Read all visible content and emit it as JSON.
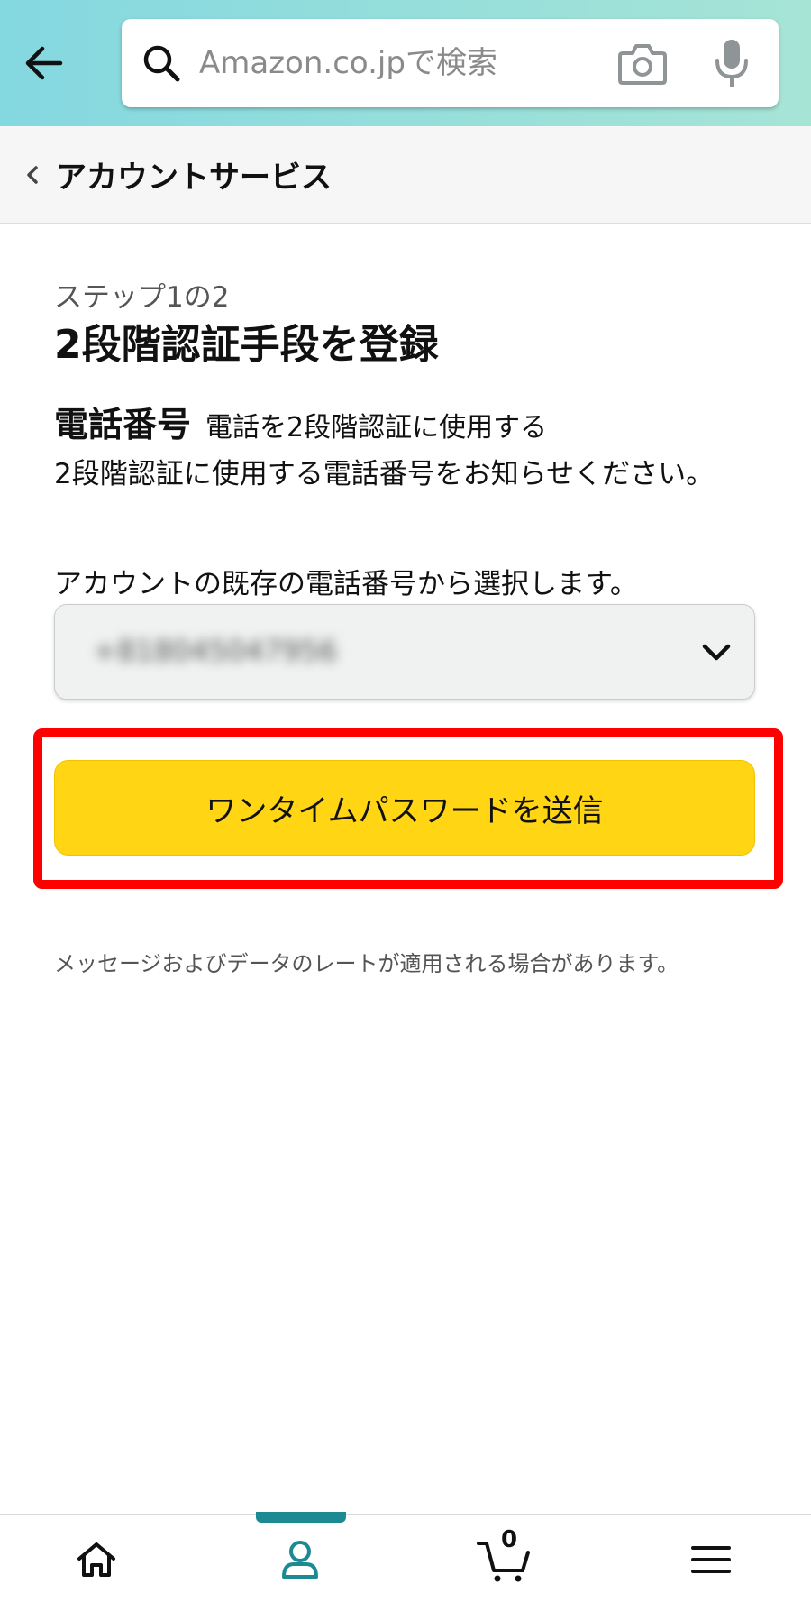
{
  "header": {
    "search_placeholder": "Amazon.co.jpで検索"
  },
  "breadcrumb": {
    "label": "アカウントサービス"
  },
  "main": {
    "step": "ステップ1の2",
    "title": "2段階認証手段を登録",
    "section_title": "電話番号",
    "section_subtitle": "電話を2段階認証に使用する",
    "description": "2段階認証に使用する電話番号をお知らせください。",
    "select_label": "アカウントの既存の電話番号から選択します。",
    "phone_value": "+818045047956",
    "send_button": "ワンタイムパスワードを送信",
    "note": "メッセージおよびデータのレートが適用される場合があります。"
  },
  "bottom_nav": {
    "cart_count": "0",
    "active_tab": "account"
  },
  "colors": {
    "header_gradient_start": "#84d8e0",
    "header_gradient_end": "#a6e4d6",
    "button_yellow": "#ffd514",
    "highlight_red": "#ff0000",
    "active_nav": "#1d8a93"
  },
  "icons": [
    "back-arrow-icon",
    "search-icon",
    "camera-icon",
    "mic-icon",
    "chevron-left-icon",
    "chevron-down-icon",
    "home-icon",
    "account-icon",
    "cart-icon",
    "menu-icon"
  ]
}
